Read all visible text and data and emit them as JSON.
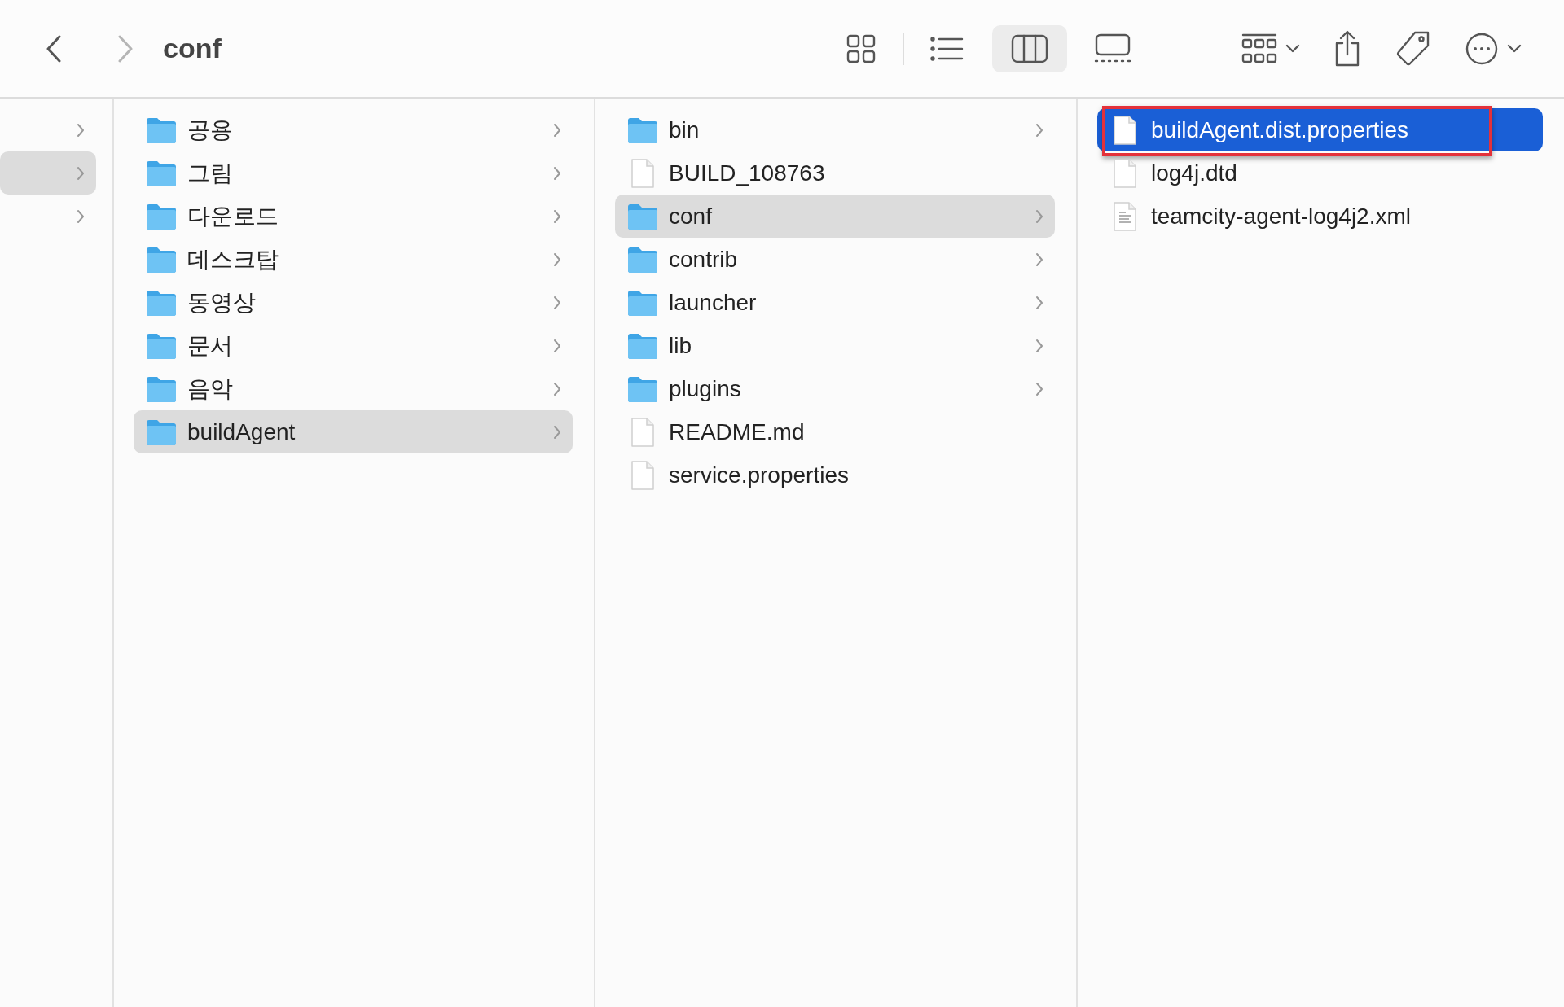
{
  "toolbar": {
    "back": {
      "disabled": false
    },
    "forward": {
      "disabled": true
    },
    "title": "conf",
    "views": [
      {
        "kind": "icons",
        "selected": false
      },
      {
        "kind": "list",
        "selected": false
      },
      {
        "kind": "columns",
        "selected": true
      },
      {
        "kind": "gallery",
        "selected": false
      }
    ]
  },
  "columns": [
    {
      "focused": false,
      "items": [
        {
          "has_children": true,
          "selected": false
        },
        {
          "has_children": true,
          "selected": true
        },
        {
          "has_children": true,
          "selected": false
        }
      ]
    },
    {
      "focused": false,
      "items": [
        {
          "name": "공용",
          "kind": "folder",
          "has_children": true,
          "selected": false
        },
        {
          "name": "그림",
          "kind": "folder",
          "has_children": true,
          "selected": false
        },
        {
          "name": "다운로드",
          "kind": "folder",
          "has_children": true,
          "selected": false
        },
        {
          "name": "데스크탑",
          "kind": "folder",
          "has_children": true,
          "selected": false
        },
        {
          "name": "동영상",
          "kind": "folder",
          "has_children": true,
          "selected": false
        },
        {
          "name": "문서",
          "kind": "folder",
          "has_children": true,
          "selected": false
        },
        {
          "name": "음악",
          "kind": "folder",
          "has_children": true,
          "selected": false
        },
        {
          "name": "buildAgent",
          "kind": "folder",
          "has_children": true,
          "selected": true
        }
      ]
    },
    {
      "focused": false,
      "items": [
        {
          "name": "bin",
          "kind": "folder",
          "has_children": true,
          "selected": false
        },
        {
          "name": "BUILD_108763",
          "kind": "file",
          "has_children": false,
          "selected": false
        },
        {
          "name": "conf",
          "kind": "folder",
          "has_children": true,
          "selected": true
        },
        {
          "name": "contrib",
          "kind": "folder",
          "has_children": true,
          "selected": false
        },
        {
          "name": "launcher",
          "kind": "folder",
          "has_children": true,
          "selected": false
        },
        {
          "name": "lib",
          "kind": "folder",
          "has_children": true,
          "selected": false
        },
        {
          "name": "plugins",
          "kind": "folder",
          "has_children": true,
          "selected": false
        },
        {
          "name": "README.md",
          "kind": "file",
          "has_children": false,
          "selected": false
        },
        {
          "name": "service.properties",
          "kind": "file",
          "has_children": false,
          "selected": false
        }
      ]
    },
    {
      "focused": true,
      "items": [
        {
          "name": "buildAgent.dist.properties",
          "kind": "file",
          "has_children": false,
          "selected": true,
          "annotated": true
        },
        {
          "name": "log4j.dtd",
          "kind": "file",
          "has_children": false,
          "selected": false
        },
        {
          "name": "teamcity-agent-log4j2.xml",
          "kind": "text-file",
          "has_children": false,
          "selected": false
        }
      ]
    }
  ]
}
